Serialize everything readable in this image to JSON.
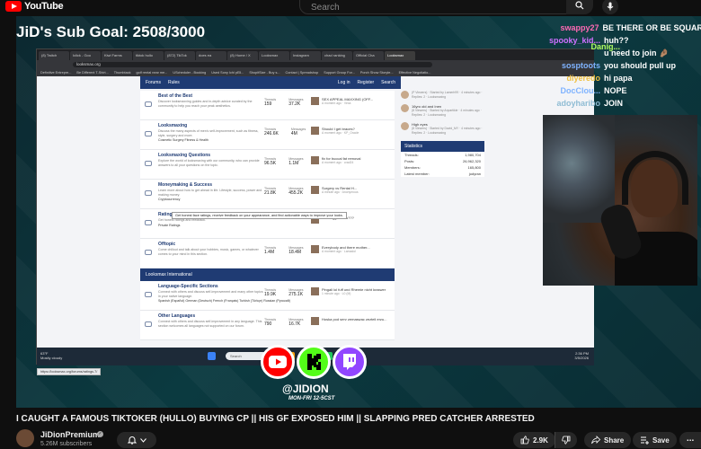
{
  "youtube": {
    "logo_text": "YouTube",
    "search_placeholder": "Search"
  },
  "stream": {
    "sub_goal": "JiD's Sub Goal: 2508/3000",
    "handle": "@JIDION",
    "schedule": "MON-FRI 12-5CST"
  },
  "chat": [
    {
      "user": "swappy27",
      "color": "#ff69b4",
      "msg": "BE THERE OR BE SQUARE"
    },
    {
      "user": "spooky_kid...",
      "color": "#d070ff",
      "msg": "huh??"
    },
    {
      "user": "",
      "color": "#ffffff",
      "msg": "u need to join 🤌🏽"
    },
    {
      "user": "sosptoots",
      "color": "#7fb3ff",
      "msg": "you should pull up"
    },
    {
      "user": "diyeredo",
      "color": "#f0c040",
      "msg": "hi papa"
    },
    {
      "user": "DocClou...",
      "color": "#7fb3ff",
      "msg": "NOPE"
    },
    {
      "user": "adoyharibo",
      "color": "#8fbcd4",
      "msg": "JOIN"
    }
  ],
  "chat_highlight": {
    "user": "Danig...",
    "color": "#b0ff60"
  },
  "browser": {
    "tabs": [
      "(8) Twitch",
      "Iclick - Goo",
      "Kiwi Farms",
      "tiktok hullo",
      "(872) TikTok",
      "does ea",
      "(8) Home / X",
      "Looksmax",
      "Instagram",
      "chad ranking",
      "Official Cha",
      "Looksmax"
    ],
    "url": "looksmax.org",
    "bookmarks": [
      "Definitive Entrepre...",
      "Be Different T-Shirt...",
      "Thumbtack",
      "golf rental near me...",
      "UScheduler - Booking",
      "Used Sony Ichi pEll...",
      "ShopitSize - Buy s...",
      "Contact | Spreadshop",
      "Support Group For...",
      "Porch Show Storyte...",
      "Effective Negotiatio..."
    ],
    "status_url": "https://looksmax.org/forums/ratings.7/"
  },
  "site": {
    "nav": {
      "forums": "Forums",
      "rules": "Rules",
      "login": "Log in",
      "register": "Register",
      "search": "Search"
    },
    "tooltip": "Get honest face ratings, receive feedback on your appearance, and find actionable ways to improve your looks.",
    "section_international": "Looksmax International",
    "forums": [
      {
        "title": "Best of the Best",
        "desc": "Discover looksmaxxing guides and in-depth advice curated by the community to help you reach your peak aesthetics.",
        "threads": "159",
        "messages": "37.2K",
        "last": "SEX APPEAL MAXXING (OFF...",
        "meta": "A moment ago · Vexa",
        "sub": ""
      },
      {
        "title": "Looksmaxing",
        "desc": "Discuss the many aspects of men's self-improvement, such as fitness, style, surgery and more.",
        "threads": "246.6K",
        "messages": "4M",
        "last": "Should I get braces?",
        "meta": "A moment ago · KP_Oracle",
        "sub": "Cosmetic Surgery   Fitness & Health"
      },
      {
        "title": "Looksmaxing Questions",
        "desc": "Explore the world of looksmaxing with our community, who can provide answers to all your questions on the topic.",
        "threads": "96.5K",
        "messages": "1.1M",
        "last": "fix for buccal fat removal",
        "meta": "A moment ago · crad24",
        "sub": ""
      },
      {
        "title": "Moneymaking & Success",
        "desc": "Learn more about how to get ahead in life. Lifestyle, success, power and making money.",
        "threads": "21.8K",
        "messages": "455.2K",
        "last": "Surgery vs Rental H...",
        "meta": "A minute ago · Anonymous",
        "sub": "Cryptocurrency"
      },
      {
        "title": "Ratings",
        "desc": "Get honest ratings and feedback.",
        "threads": "",
        "messages": "",
        "last": "and suggestions???",
        "meta": "",
        "sub": "Private Ratings"
      },
      {
        "title": "Offtopic",
        "desc": "Come chillout and talk about your hobbies, music, games, or whatever comes to your mind in this section.",
        "threads": "1.4M",
        "messages": "18.4M",
        "last": "Everybody and there mother...",
        "meta": "A moment ago · Lamadol",
        "sub": ""
      }
    ],
    "intl_forums": [
      {
        "title": "Language-Specific Sections",
        "desc": "Connect with others and discuss self-improvement and many other topics in your native language.",
        "threads": "19.9K",
        "messages": "275.1K",
        "last": "Pingali lol fuff und Rhemie nicht kraswer",
        "meta": "1 minute ago · L0 (M)",
        "sub": "Spanish (Español)   German (Deutsch)   French (Français)   Turkish (Türkçe)   Russian (Pусский)"
      },
      {
        "title": "Other Languages",
        "desc": "Connect with others and discuss self-improvement in any language. This section welcomes all languages not supported on our forum.",
        "threads": "790",
        "messages": "16.7K",
        "last": "Hoska pod serv zemaswac zezteli erzu...",
        "meta": "",
        "sub": ""
      }
    ],
    "side_threads": [
      {
        "title": "",
        "meta": "(P Viewers) · Started by Lamerh99 · 4 minutes ago · Replies: 2 · Looksmaxing"
      },
      {
        "title": "16yro old and Inen",
        "meta": "(8 Viewers) · Started by Anpartikle · 4 minutes ago · Replies: 2 · Looksmaxing"
      },
      {
        "title": "High eyes",
        "meta": "(8 Viewers) · Started by David_MY · 4 minutes ago · Replies: 2 · Looksmaxing"
      }
    ],
    "stats_title": "Statistics",
    "stats": [
      {
        "label": "Threads:",
        "value": "1,980,704"
      },
      {
        "label": "Posts:",
        "value": "26,962,320"
      },
      {
        "label": "Members:",
        "value": "165,800"
      },
      {
        "label": "Latest member:",
        "value": "jodyran"
      }
    ]
  },
  "taskbar": {
    "weather_temp": "63°F",
    "weather_text": "Mostly cloudy",
    "search": "Search",
    "time": "2:36 PM",
    "date": "3/5/2026"
  },
  "video": {
    "title": "I CAUGHT A FAMOUS TIKTOKER (HULLO) BUYING CP || HIS GF EXPOSED HIM || SLAPPING PRED CATCHER ARRESTED",
    "channel": "JiDionPremium",
    "subscribers": "5.26M subscribers",
    "likes": "2.9K",
    "share": "Share",
    "save": "Save"
  },
  "colors": {
    "youtube_red": "#ff0000",
    "kick_green": "#53fc18",
    "twitch_purple": "#9146ff",
    "forum_navy": "#1f3b73"
  }
}
